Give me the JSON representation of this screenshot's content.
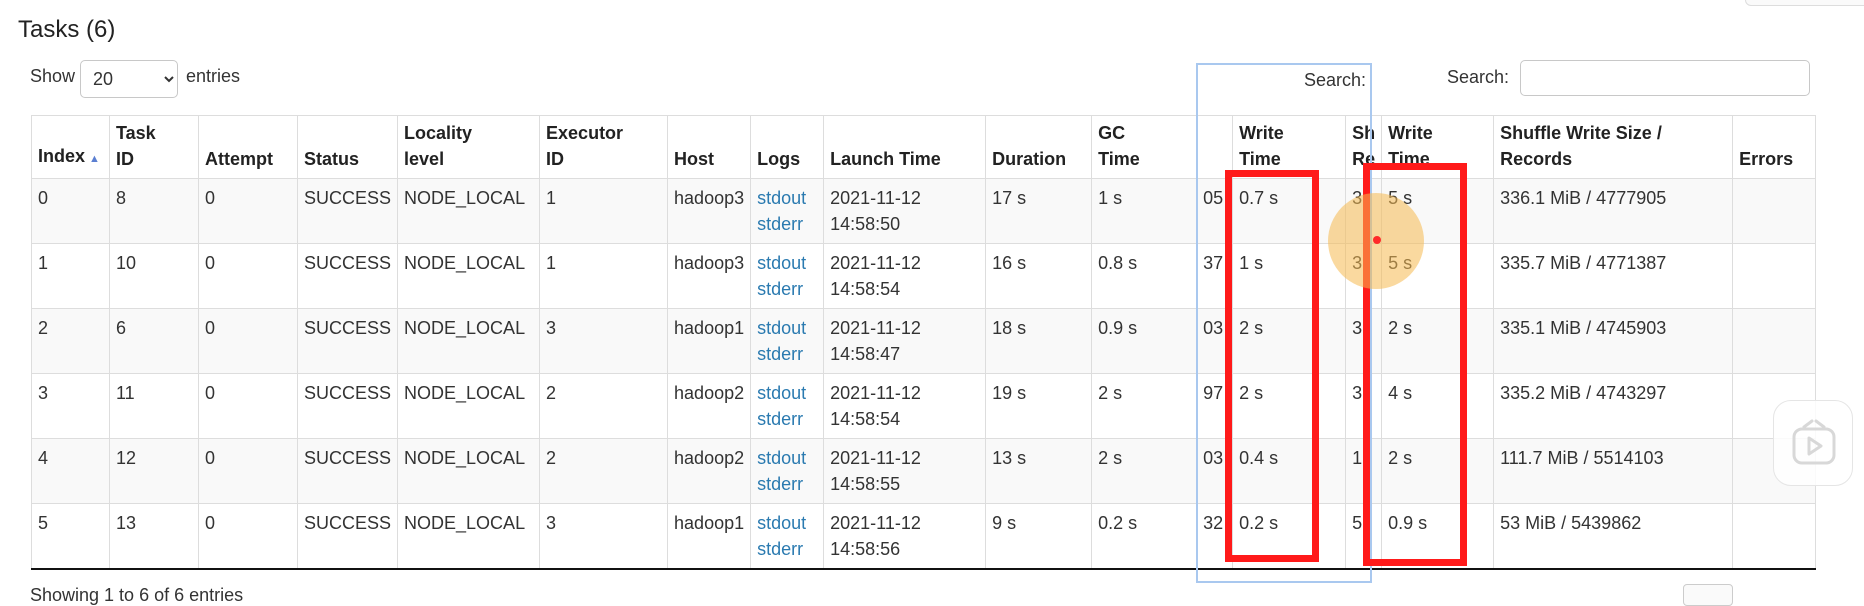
{
  "page": {
    "title": "Tasks (6)"
  },
  "length": {
    "show_label": "Show",
    "selected": "20",
    "entries_label": "entries"
  },
  "search": {
    "label": "Search:",
    "placeholder": ""
  },
  "overlay_search_label": "Search:",
  "table": {
    "headers": {
      "index": "Index",
      "task_id": [
        "Task",
        "ID"
      ],
      "attempt": "Attempt",
      "status": "Status",
      "locality": [
        "Locality",
        "level"
      ],
      "executor": [
        "Executor",
        "ID"
      ],
      "host": "Host",
      "logs": "Logs",
      "launch": "Launch Time",
      "duration": "Duration",
      "gc": [
        "GC",
        "Time"
      ],
      "write_time_1": [
        "Write",
        "Time"
      ],
      "shuffle_read_frag": [
        "Sh",
        "Re"
      ],
      "write_time_2": [
        "Write",
        "Time"
      ],
      "shuffle_write": [
        "Shuffle Write Size /",
        "Records"
      ],
      "errors": "Errors"
    },
    "rows": [
      {
        "index": "0",
        "task_id": "8",
        "attempt": "0",
        "status": "SUCCESS",
        "locality": "NODE_LOCAL",
        "executor": "1",
        "host": "hadoop3",
        "stdout": "stdout",
        "stderr": "stderr",
        "launch_date": "2021-11-12",
        "launch_time": "14:58:50",
        "duration": "17 s",
        "gc": "1 s",
        "frag_a": "05",
        "write_time_1": "0.7 s",
        "frag_b": "3",
        "write_time_2": "5 s",
        "shuffle_write": "336.1 MiB / 4777905",
        "errors": ""
      },
      {
        "index": "1",
        "task_id": "10",
        "attempt": "0",
        "status": "SUCCESS",
        "locality": "NODE_LOCAL",
        "executor": "1",
        "host": "hadoop3",
        "stdout": "stdout",
        "stderr": "stderr",
        "launch_date": "2021-11-12",
        "launch_time": "14:58:54",
        "duration": "16 s",
        "gc": "0.8 s",
        "frag_a": "37",
        "write_time_1": "1 s",
        "frag_b": "3",
        "write_time_2": "5 s",
        "shuffle_write": "335.7 MiB / 4771387",
        "errors": ""
      },
      {
        "index": "2",
        "task_id": "6",
        "attempt": "0",
        "status": "SUCCESS",
        "locality": "NODE_LOCAL",
        "executor": "3",
        "host": "hadoop1",
        "stdout": "stdout",
        "stderr": "stderr",
        "launch_date": "2021-11-12",
        "launch_time": "14:58:47",
        "duration": "18 s",
        "gc": "0.9 s",
        "frag_a": "03",
        "write_time_1": "2 s",
        "frag_b": "3",
        "write_time_2": "2 s",
        "shuffle_write": "335.1 MiB / 4745903",
        "errors": ""
      },
      {
        "index": "3",
        "task_id": "11",
        "attempt": "0",
        "status": "SUCCESS",
        "locality": "NODE_LOCAL",
        "executor": "2",
        "host": "hadoop2",
        "stdout": "stdout",
        "stderr": "stderr",
        "launch_date": "2021-11-12",
        "launch_time": "14:58:54",
        "duration": "19 s",
        "gc": "2 s",
        "frag_a": "97",
        "write_time_1": "2 s",
        "frag_b": "3",
        "write_time_2": "4 s",
        "shuffle_write": "335.2 MiB / 4743297",
        "errors": ""
      },
      {
        "index": "4",
        "task_id": "12",
        "attempt": "0",
        "status": "SUCCESS",
        "locality": "NODE_LOCAL",
        "executor": "2",
        "host": "hadoop2",
        "stdout": "stdout",
        "stderr": "stderr",
        "launch_date": "2021-11-12",
        "launch_time": "14:58:55",
        "duration": "13 s",
        "gc": "2 s",
        "frag_a": "03",
        "write_time_1": "0.4 s",
        "frag_b": "1",
        "write_time_2": "2 s",
        "shuffle_write": "111.7 MiB / 5514103",
        "errors": ""
      },
      {
        "index": "5",
        "task_id": "13",
        "attempt": "0",
        "status": "SUCCESS",
        "locality": "NODE_LOCAL",
        "executor": "3",
        "host": "hadoop1",
        "stdout": "stdout",
        "stderr": "stderr",
        "launch_date": "2021-11-12",
        "launch_time": "14:58:56",
        "duration": "9 s",
        "gc": "0.2 s",
        "frag_a": "32",
        "write_time_1": "0.2 s",
        "frag_b": "5",
        "write_time_2": "0.9 s",
        "shuffle_write": "53 MiB / 5439862",
        "errors": ""
      }
    ]
  },
  "footer": {
    "info": "Showing 1 to 6 of 6 entries"
  },
  "colors": {
    "link": "#2a7ab0",
    "highlight_box": "#ff1a1a",
    "sort_arrow": "#5b7fd1",
    "row_stripe": "#f9f9f9"
  },
  "icons": {
    "sort": "sort-ascending-icon",
    "play": "play-icon",
    "dropdown": "chevron-down-icon"
  }
}
